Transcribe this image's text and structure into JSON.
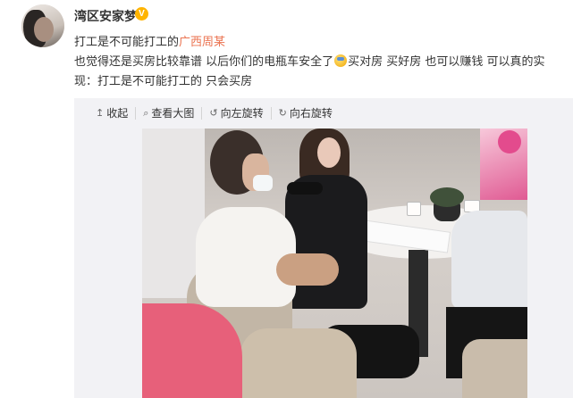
{
  "user": {
    "name": "湾区安家梦",
    "verified_badge": "V"
  },
  "post": {
    "line1_prefix": "打工是不可能打工的",
    "line1_link": "广西周某",
    "line2_a": "也觉得还是买房比较靠谱 以后你们的电瓶车安全了",
    "line2_b": "买对房 买好房 也可以赚钱 可以真的实",
    "line3": "现：打工是不可能打工的 只会买房"
  },
  "toolbar": {
    "collapse": {
      "icon": "↥",
      "label": "收起"
    },
    "view_large": {
      "icon": "⌕",
      "label": "查看大图"
    },
    "rotate_left": {
      "icon": "↺",
      "label": "向左旋转"
    },
    "rotate_right": {
      "icon": "↻",
      "label": "向右旋转"
    }
  },
  "colors": {
    "link": "#eb7350",
    "badge": "#ffb400",
    "panel_bg": "#f2f2f5"
  },
  "icons": {
    "emoji": "emoji-icon",
    "verified": "verified-badge-icon"
  }
}
